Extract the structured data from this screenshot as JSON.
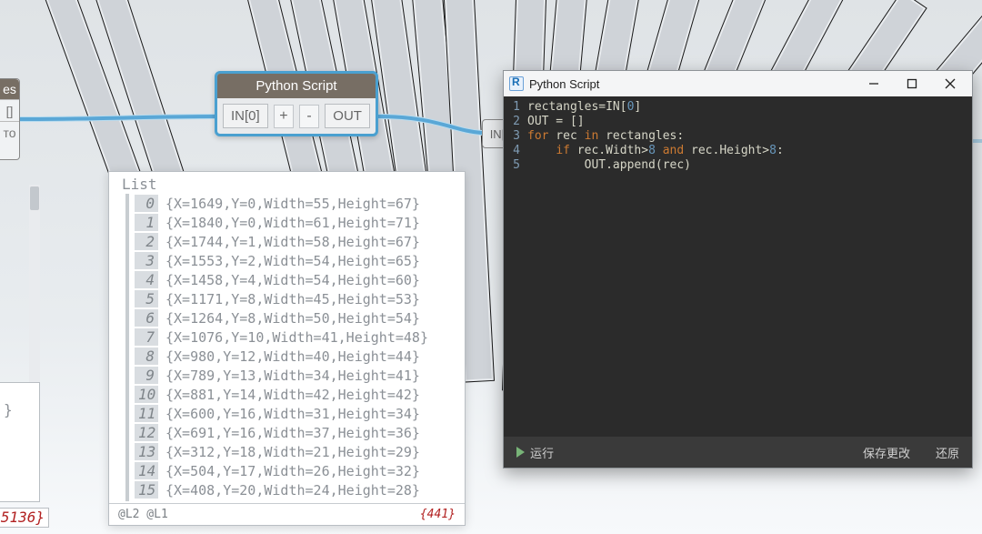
{
  "leftNode": {
    "cap": "es",
    "r1": "[]",
    "r2": "то"
  },
  "node": {
    "title": "Python Script",
    "portIn": "IN[0]",
    "plus": "+",
    "minus": "-",
    "portOut": "OUT"
  },
  "miniNode": "IN[",
  "panel": {
    "title": "List",
    "items": [
      {
        "i": "0",
        "v": "{X=1649,Y=0,Width=55,Height=67}"
      },
      {
        "i": "1",
        "v": "{X=1840,Y=0,Width=61,Height=71}"
      },
      {
        "i": "2",
        "v": "{X=1744,Y=1,Width=58,Height=67}"
      },
      {
        "i": "3",
        "v": "{X=1553,Y=2,Width=54,Height=65}"
      },
      {
        "i": "4",
        "v": "{X=1458,Y=4,Width=54,Height=60}"
      },
      {
        "i": "5",
        "v": "{X=1171,Y=8,Width=45,Height=53}"
      },
      {
        "i": "6",
        "v": "{X=1264,Y=8,Width=50,Height=54}"
      },
      {
        "i": "7",
        "v": "{X=1076,Y=10,Width=41,Height=48}"
      },
      {
        "i": "8",
        "v": "{X=980,Y=12,Width=40,Height=44}"
      },
      {
        "i": "9",
        "v": "{X=789,Y=13,Width=34,Height=41}"
      },
      {
        "i": "10",
        "v": "{X=881,Y=14,Width=42,Height=42}"
      },
      {
        "i": "11",
        "v": "{X=600,Y=16,Width=31,Height=34}"
      },
      {
        "i": "12",
        "v": "{X=691,Y=16,Width=37,Height=36}"
      },
      {
        "i": "13",
        "v": "{X=312,Y=18,Width=21,Height=29}"
      },
      {
        "i": "14",
        "v": "{X=504,Y=17,Width=26,Height=32}"
      },
      {
        "i": "15",
        "v": "{X=408,Y=20,Width=24,Height=28}"
      }
    ],
    "footerLeft": "@L2 @L1",
    "footerCount": "{441}"
  },
  "bottomLeft1": "}",
  "bottomLeft2": "5136}",
  "editor": {
    "title": "Python Script",
    "code": {
      "l1a": "rectangles=IN[",
      "l1b": "0",
      "l1c": "]",
      "l2": "OUT = []",
      "l3a": "for",
      "l3b": " rec ",
      "l3c": "in",
      "l3d": " rectangles:",
      "l4a": "    ",
      "l4b": "if",
      "l4c": " rec.Width>",
      "l4d": "8",
      "l4e": " ",
      "l4f": "and",
      "l4g": " rec.Height>",
      "l4h": "8",
      "l4i": ":",
      "l5": "        OUT.append(rec)"
    },
    "gutter": [
      "1",
      "2",
      "3",
      "4",
      "5"
    ],
    "run": "运行",
    "save": "保存更改",
    "revert": "还原"
  }
}
